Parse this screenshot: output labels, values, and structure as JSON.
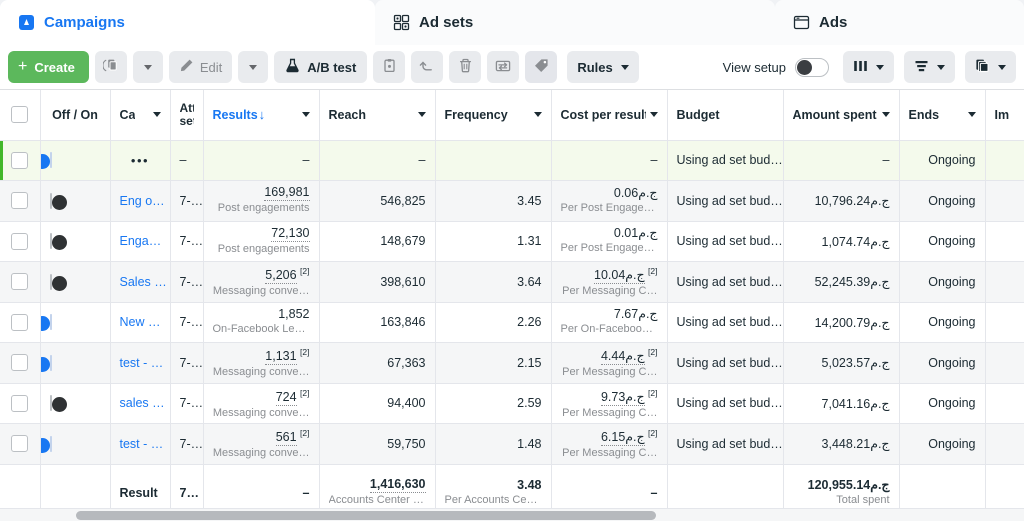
{
  "tabs": [
    {
      "label": "Campaigns",
      "icon": "campaigns-flag-icon",
      "active": true
    },
    {
      "label": "Ad sets",
      "icon": "adsets-grid-icon",
      "active": false
    },
    {
      "label": "Ads",
      "icon": "ads-window-icon",
      "active": false
    }
  ],
  "toolbar": {
    "create_label": "Create",
    "create_plus": "+",
    "duplicate_icon": "duplicate-icon",
    "duplicate_caret_icon": "chevron-down-icon",
    "edit_label": "Edit",
    "edit_icon": "pencil-icon",
    "edit_caret_icon": "chevron-down-icon",
    "abtest_label": "A/B test",
    "abtest_icon": "flask-icon",
    "clipboard_icon": "clipboard-icon",
    "undo_icon": "undo-arrow-icon",
    "delete_icon": "trash-icon",
    "exchange_icon": "exchange-arrows-icon",
    "tag_icon": "tag-icon",
    "rules_label": "Rules",
    "rules_caret_icon": "chevron-down-icon",
    "view_setup_label": "View setup",
    "view_setup_toggle": "off",
    "columns_icon": "columns-icon",
    "breakdown_icon": "breakdown-icon",
    "reports_icon": "reports-icon",
    "accent_green": "#5cb85c",
    "accent_blue": "#1877f2"
  },
  "table": {
    "columns": [
      {
        "key": "check",
        "label": "",
        "sortable": false,
        "caret": false
      },
      {
        "key": "onoff",
        "label": "Off / On",
        "sortable": false,
        "caret": false
      },
      {
        "key": "name",
        "label": "Ca",
        "sortable": false,
        "caret": true
      },
      {
        "key": "attr",
        "label": "Attr setti",
        "sortable": false,
        "caret": false
      },
      {
        "key": "results",
        "label": "Results",
        "sortable": true,
        "caret": true,
        "sort_dir": "↓"
      },
      {
        "key": "reach",
        "label": "Reach",
        "sortable": false,
        "caret": true
      },
      {
        "key": "freq",
        "label": "Frequency",
        "sortable": false,
        "caret": true
      },
      {
        "key": "cpr",
        "label": "Cost per result",
        "sortable": false,
        "caret": true
      },
      {
        "key": "budget",
        "label": "Budget",
        "sortable": false,
        "caret": false
      },
      {
        "key": "spent",
        "label": "Amount spent",
        "sortable": false,
        "caret": true
      },
      {
        "key": "ends",
        "label": "Ends",
        "sortable": false,
        "caret": true
      },
      {
        "key": "imp",
        "label": "Im",
        "sortable": false,
        "caret": false
      }
    ],
    "rows": [
      {
        "selected": false,
        "highlight": true,
        "toggle": "on",
        "name": "",
        "name_is_dots": true,
        "attr": "–",
        "attr_dash": true,
        "results": "–",
        "results_dash": true,
        "results_sub": "",
        "reach": "–",
        "reach_dash": true,
        "freq": "",
        "freq_dash": false,
        "cpr": "–",
        "cpr_dash": true,
        "cpr_sub": "",
        "budget": "Using ad set bud…",
        "spent": "–",
        "spent_dash": true,
        "ends": "Ongoing"
      },
      {
        "selected": false,
        "highlight": false,
        "toggle": "off",
        "name": "Eng o…",
        "attr": "7-…",
        "results": "169,981",
        "results_sub": "Post engagements",
        "results_dotted": true,
        "reach": "546,825",
        "freq": "3.45",
        "cpr": "0.06ج.م",
        "cpr_sub": "Per Post Engagement",
        "budget": "Using ad set bud…",
        "spent": "10,796.24ج.م",
        "ends": "Ongoing"
      },
      {
        "selected": false,
        "highlight": false,
        "toggle": "off",
        "name": "Enga…",
        "attr": "7-…",
        "results": "72,130",
        "results_sub": "Post engagements",
        "results_dotted": true,
        "reach": "148,679",
        "freq": "1.31",
        "cpr": "0.01ج.م",
        "cpr_sub": "Per Post Engagement",
        "budget": "Using ad set bud…",
        "spent": "1,074.74ج.م",
        "ends": "Ongoing"
      },
      {
        "selected": false,
        "highlight": false,
        "toggle": "off",
        "name": "Sales …",
        "attr": "7-…",
        "results": "5,206",
        "results_sup": "[2]",
        "results_sub": "Messaging conve…",
        "results_dotted": true,
        "reach": "398,610",
        "freq": "3.64",
        "cpr": "10.04ج.م",
        "cpr_sup": "[2]",
        "cpr_sub": "Per Messaging C…",
        "cpr_dotted": true,
        "budget": "Using ad set bud…",
        "spent": "52,245.39ج.م",
        "ends": "Ongoing"
      },
      {
        "selected": false,
        "highlight": false,
        "toggle": "on",
        "name": "New …",
        "attr": "7-…",
        "results": "1,852",
        "results_sub": "On-Facebook Leads",
        "reach": "163,846",
        "freq": "2.26",
        "cpr": "7.67ج.م",
        "cpr_sub": "Per On-Facebook Le…",
        "budget": "Using ad set bud…",
        "spent": "14,200.79ج.م",
        "ends": "Ongoing"
      },
      {
        "selected": false,
        "highlight": false,
        "toggle": "on",
        "name": "test - …",
        "attr": "7-…",
        "results": "1,131",
        "results_sup": "[2]",
        "results_sub": "Messaging conve…",
        "results_dotted": true,
        "reach": "67,363",
        "freq": "2.15",
        "cpr": "4.44ج.م",
        "cpr_sup": "[2]",
        "cpr_sub": "Per Messaging C…",
        "cpr_dotted": true,
        "budget": "Using ad set bud…",
        "spent": "5,023.57ج.م",
        "ends": "Ongoing"
      },
      {
        "selected": false,
        "highlight": false,
        "toggle": "off",
        "name": "sales …",
        "attr": "7-…",
        "results": "724",
        "results_sup": "[2]",
        "results_sub": "Messaging conve…",
        "results_dotted": true,
        "reach": "94,400",
        "freq": "2.59",
        "cpr": "9.73ج.م",
        "cpr_sup": "[2]",
        "cpr_sub": "Per Messaging C…",
        "cpr_dotted": true,
        "budget": "Using ad set bud…",
        "spent": "7,041.16ج.م",
        "ends": "Ongoing"
      },
      {
        "selected": false,
        "highlight": false,
        "toggle": "on",
        "name": "test - …",
        "attr": "7-…",
        "results": "561",
        "results_sup": "[2]",
        "results_sub": "Messaging conve…",
        "results_dotted": true,
        "reach": "59,750",
        "freq": "1.48",
        "cpr": "6.15ج.م",
        "cpr_sup": "[2]",
        "cpr_sub": "Per Messaging C…",
        "cpr_dotted": true,
        "budget": "Using ad set bud…",
        "spent": "3,448.21ج.م",
        "ends": "Ongoing"
      }
    ],
    "summary": {
      "label": "Result",
      "attr": "7…",
      "results": "–",
      "reach": "1,416,630",
      "reach_sub": "Accounts Center ac…",
      "freq": "3.48",
      "freq_sub": "Per Accounts Cente…",
      "cpr": "–",
      "budget": "",
      "spent": "120,955.14ج.م",
      "spent_sub": "Total spent",
      "ends": ""
    }
  }
}
